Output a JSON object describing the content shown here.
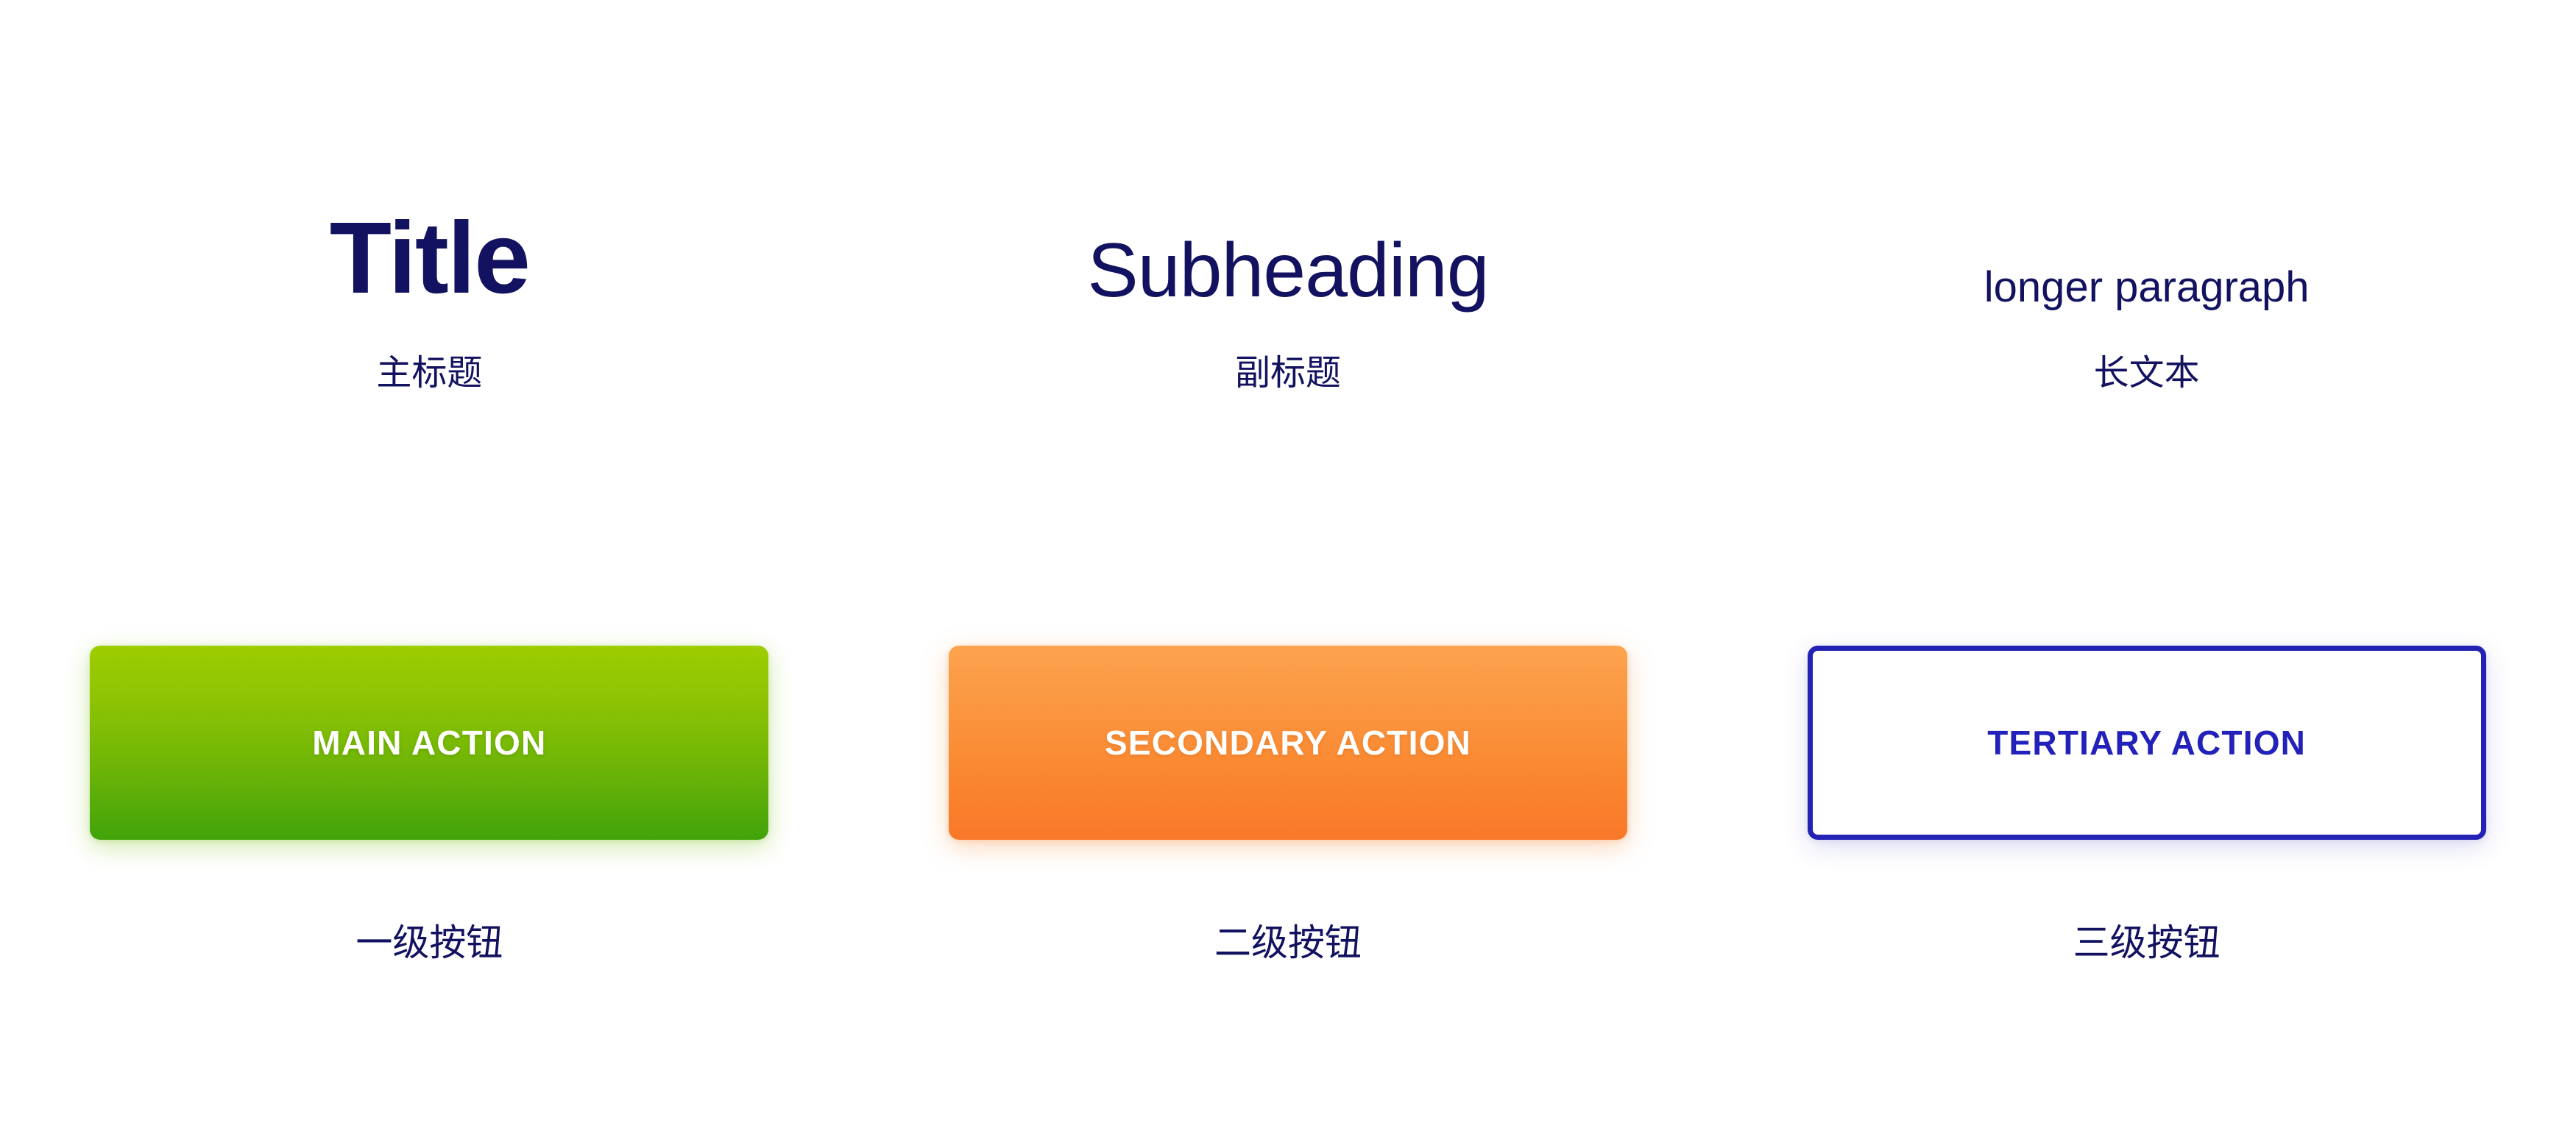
{
  "page": {
    "background_color": "#ffffff",
    "text_color": "#121260"
  },
  "typography": {
    "samples": [
      {
        "sample_text": "Title",
        "caption": "主标题",
        "style_name": "title",
        "color": "#121260"
      },
      {
        "sample_text": "Subheading",
        "caption": "副标题",
        "style_name": "subheading",
        "color": "#121260"
      },
      {
        "sample_text": "longer paragraph",
        "caption": "长文本",
        "style_name": "paragraph",
        "color": "#121260"
      }
    ]
  },
  "buttons": {
    "items": [
      {
        "label": "MAIN ACTION",
        "caption": "一级按钮",
        "variant": "primary",
        "gradient_top": "#9ecd00",
        "gradient_bottom": "#41a30a",
        "label_color": "#ffffff"
      },
      {
        "label": "SECONDARY ACTION",
        "caption": "二级按钮",
        "variant": "secondary",
        "gradient_top": "#fca34f",
        "gradient_bottom": "#f9782a",
        "label_color": "#ffffff"
      },
      {
        "label": "TERTIARY ACTION",
        "caption": "三级按钮",
        "variant": "tertiary",
        "background_color": "#ffffff",
        "border_color": "#2222b4",
        "label_color": "#2222bb"
      }
    ]
  }
}
